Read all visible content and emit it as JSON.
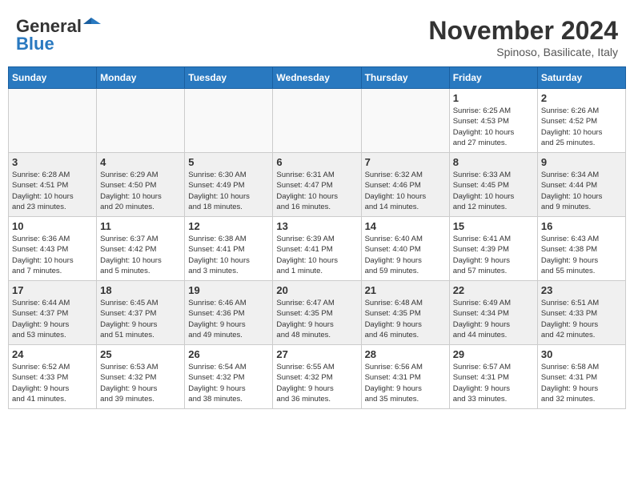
{
  "header": {
    "logo_line1": "General",
    "logo_line2": "Blue",
    "month": "November 2024",
    "location": "Spinoso, Basilicate, Italy"
  },
  "weekdays": [
    "Sunday",
    "Monday",
    "Tuesday",
    "Wednesday",
    "Thursday",
    "Friday",
    "Saturday"
  ],
  "weeks": [
    [
      {
        "day": "",
        "info": ""
      },
      {
        "day": "",
        "info": ""
      },
      {
        "day": "",
        "info": ""
      },
      {
        "day": "",
        "info": ""
      },
      {
        "day": "",
        "info": ""
      },
      {
        "day": "1",
        "info": "Sunrise: 6:25 AM\nSunset: 4:53 PM\nDaylight: 10 hours\nand 27 minutes."
      },
      {
        "day": "2",
        "info": "Sunrise: 6:26 AM\nSunset: 4:52 PM\nDaylight: 10 hours\nand 25 minutes."
      }
    ],
    [
      {
        "day": "3",
        "info": "Sunrise: 6:28 AM\nSunset: 4:51 PM\nDaylight: 10 hours\nand 23 minutes."
      },
      {
        "day": "4",
        "info": "Sunrise: 6:29 AM\nSunset: 4:50 PM\nDaylight: 10 hours\nand 20 minutes."
      },
      {
        "day": "5",
        "info": "Sunrise: 6:30 AM\nSunset: 4:49 PM\nDaylight: 10 hours\nand 18 minutes."
      },
      {
        "day": "6",
        "info": "Sunrise: 6:31 AM\nSunset: 4:47 PM\nDaylight: 10 hours\nand 16 minutes."
      },
      {
        "day": "7",
        "info": "Sunrise: 6:32 AM\nSunset: 4:46 PM\nDaylight: 10 hours\nand 14 minutes."
      },
      {
        "day": "8",
        "info": "Sunrise: 6:33 AM\nSunset: 4:45 PM\nDaylight: 10 hours\nand 12 minutes."
      },
      {
        "day": "9",
        "info": "Sunrise: 6:34 AM\nSunset: 4:44 PM\nDaylight: 10 hours\nand 9 minutes."
      }
    ],
    [
      {
        "day": "10",
        "info": "Sunrise: 6:36 AM\nSunset: 4:43 PM\nDaylight: 10 hours\nand 7 minutes."
      },
      {
        "day": "11",
        "info": "Sunrise: 6:37 AM\nSunset: 4:42 PM\nDaylight: 10 hours\nand 5 minutes."
      },
      {
        "day": "12",
        "info": "Sunrise: 6:38 AM\nSunset: 4:41 PM\nDaylight: 10 hours\nand 3 minutes."
      },
      {
        "day": "13",
        "info": "Sunrise: 6:39 AM\nSunset: 4:41 PM\nDaylight: 10 hours\nand 1 minute."
      },
      {
        "day": "14",
        "info": "Sunrise: 6:40 AM\nSunset: 4:40 PM\nDaylight: 9 hours\nand 59 minutes."
      },
      {
        "day": "15",
        "info": "Sunrise: 6:41 AM\nSunset: 4:39 PM\nDaylight: 9 hours\nand 57 minutes."
      },
      {
        "day": "16",
        "info": "Sunrise: 6:43 AM\nSunset: 4:38 PM\nDaylight: 9 hours\nand 55 minutes."
      }
    ],
    [
      {
        "day": "17",
        "info": "Sunrise: 6:44 AM\nSunset: 4:37 PM\nDaylight: 9 hours\nand 53 minutes."
      },
      {
        "day": "18",
        "info": "Sunrise: 6:45 AM\nSunset: 4:37 PM\nDaylight: 9 hours\nand 51 minutes."
      },
      {
        "day": "19",
        "info": "Sunrise: 6:46 AM\nSunset: 4:36 PM\nDaylight: 9 hours\nand 49 minutes."
      },
      {
        "day": "20",
        "info": "Sunrise: 6:47 AM\nSunset: 4:35 PM\nDaylight: 9 hours\nand 48 minutes."
      },
      {
        "day": "21",
        "info": "Sunrise: 6:48 AM\nSunset: 4:35 PM\nDaylight: 9 hours\nand 46 minutes."
      },
      {
        "day": "22",
        "info": "Sunrise: 6:49 AM\nSunset: 4:34 PM\nDaylight: 9 hours\nand 44 minutes."
      },
      {
        "day": "23",
        "info": "Sunrise: 6:51 AM\nSunset: 4:33 PM\nDaylight: 9 hours\nand 42 minutes."
      }
    ],
    [
      {
        "day": "24",
        "info": "Sunrise: 6:52 AM\nSunset: 4:33 PM\nDaylight: 9 hours\nand 41 minutes."
      },
      {
        "day": "25",
        "info": "Sunrise: 6:53 AM\nSunset: 4:32 PM\nDaylight: 9 hours\nand 39 minutes."
      },
      {
        "day": "26",
        "info": "Sunrise: 6:54 AM\nSunset: 4:32 PM\nDaylight: 9 hours\nand 38 minutes."
      },
      {
        "day": "27",
        "info": "Sunrise: 6:55 AM\nSunset: 4:32 PM\nDaylight: 9 hours\nand 36 minutes."
      },
      {
        "day": "28",
        "info": "Sunrise: 6:56 AM\nSunset: 4:31 PM\nDaylight: 9 hours\nand 35 minutes."
      },
      {
        "day": "29",
        "info": "Sunrise: 6:57 AM\nSunset: 4:31 PM\nDaylight: 9 hours\nand 33 minutes."
      },
      {
        "day": "30",
        "info": "Sunrise: 6:58 AM\nSunset: 4:31 PM\nDaylight: 9 hours\nand 32 minutes."
      }
    ]
  ]
}
